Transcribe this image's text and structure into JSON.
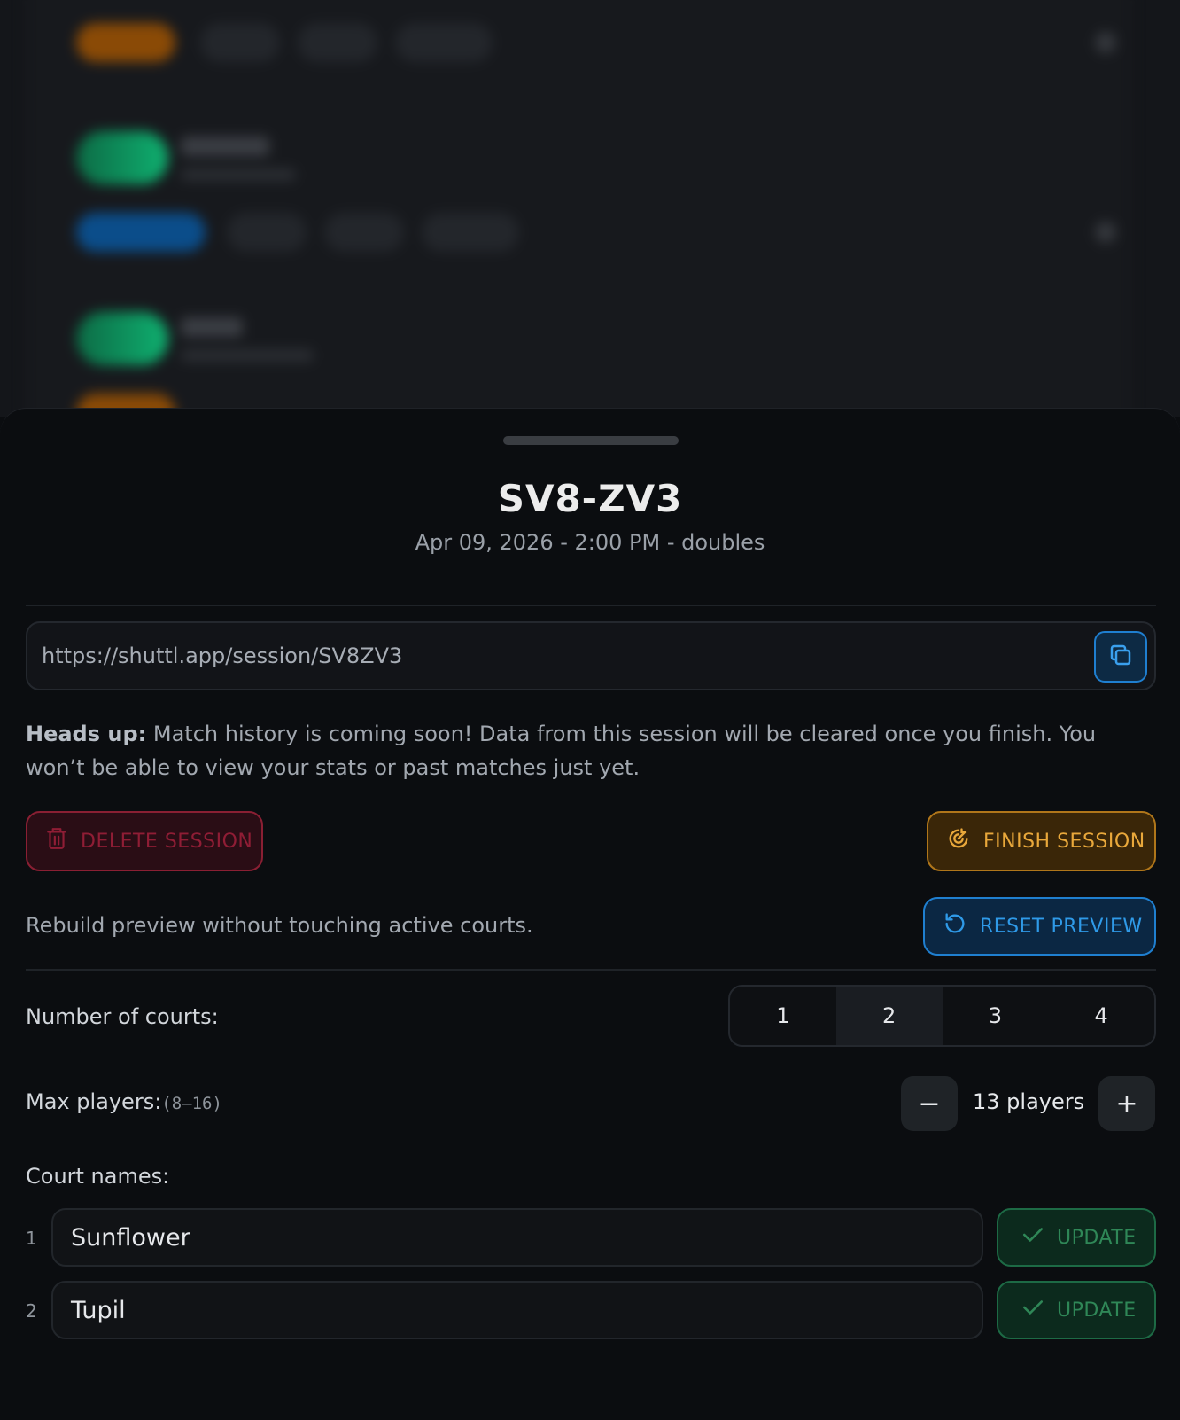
{
  "session": {
    "code": "SV8-ZV3",
    "meta": "Apr 09, 2026 - 2:00 PM - doubles",
    "url": "https://shuttl.app/session/SV8ZV3"
  },
  "notice": {
    "lead": "Heads up:",
    "body": " Match history is coming soon! Data from this session will be cleared once you finish. You won’t be able to view your stats or past matches just yet."
  },
  "actions": {
    "delete_label": "DELETE SESSION",
    "finish_label": "FINISH SESSION",
    "rebuild_text": "Rebuild preview without touching active courts.",
    "reset_label": "RESET PREVIEW"
  },
  "courts": {
    "label": "Number of courts:",
    "options": [
      "1",
      "2",
      "3",
      "4"
    ],
    "selected": "2"
  },
  "max_players": {
    "label": "Max players:",
    "range": "(8–16)",
    "value": "13 players",
    "decrement": "−",
    "increment": "+"
  },
  "court_names": {
    "label": "Court names:",
    "rows": [
      {
        "number": "1",
        "name": "Sunflower",
        "button": "UPDATE"
      },
      {
        "number": "2",
        "name": "Tupil",
        "button": "UPDATE"
      }
    ]
  },
  "colors": {
    "danger": "#8f1d35",
    "warning": "#e9a83b",
    "info": "#2f9ae8",
    "success": "#2f8757"
  }
}
